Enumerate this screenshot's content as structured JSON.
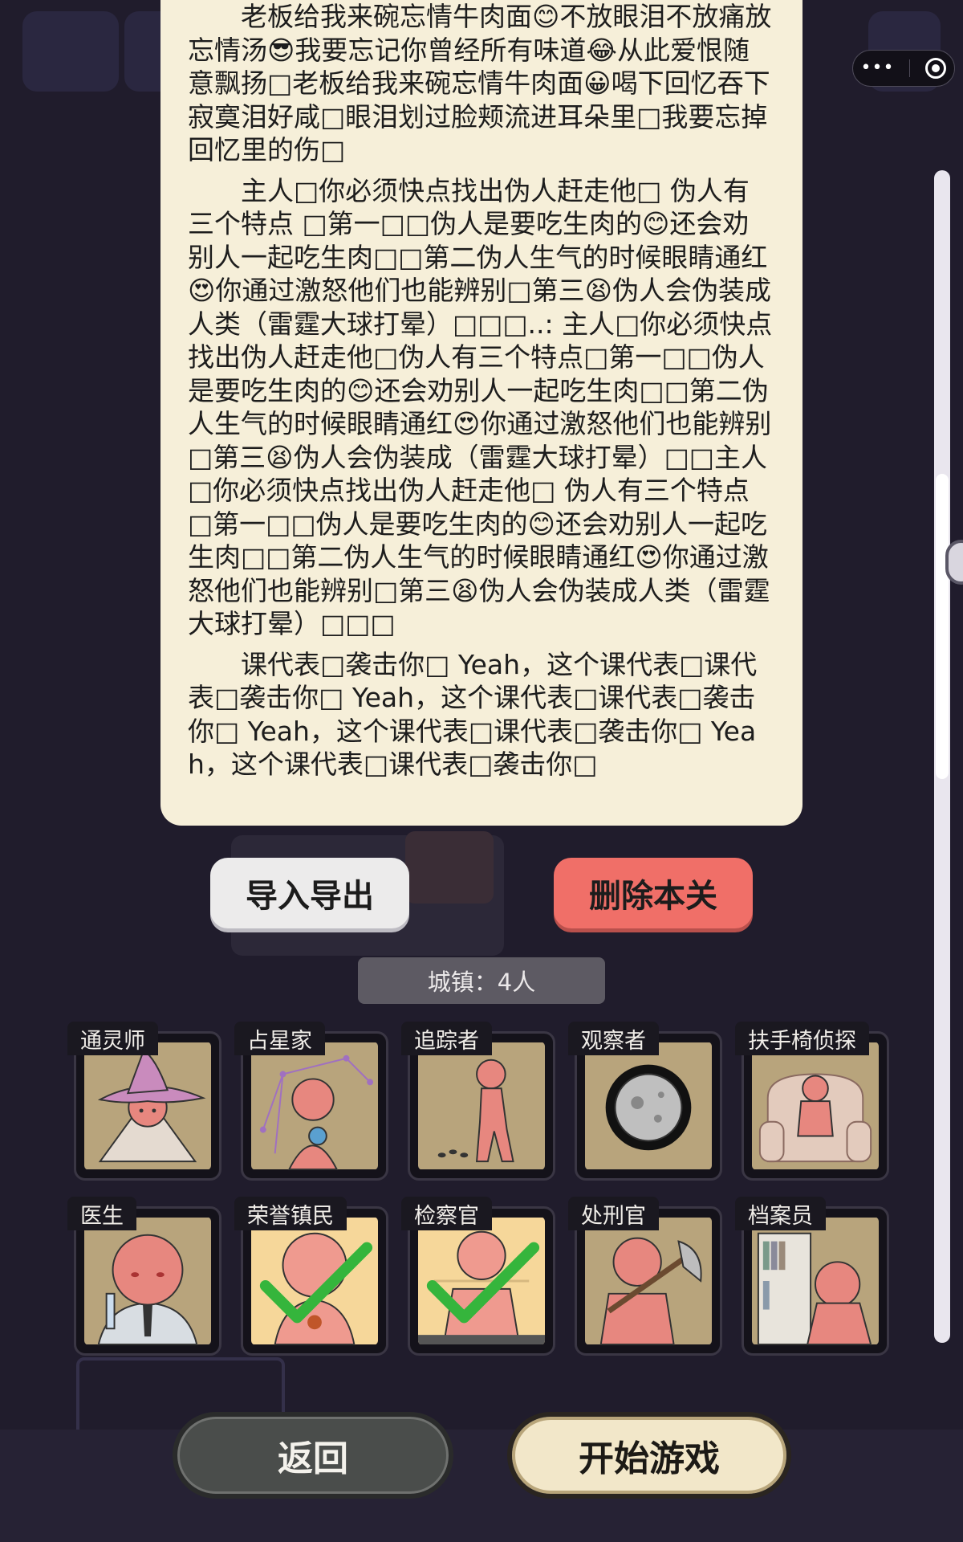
{
  "text_panel": {
    "paragraphs": [
      "老板给我来碗忘情牛肉面😊不放眼泪不放痛放忘情汤😎我要忘记你曾经所有味道😂从此爱恨随意飘扬□老板给我来碗忘情牛肉面😀喝下回忆吞下寂寞泪好咸□眼泪划过脸颊流进耳朵里□我要忘掉回忆里的伤□",
      "主人□你必须快点找出伪人赶走他□ 伪人有三个特点 □第一□□伪人是要吃生肉的😊还会劝别人一起吃生肉□□第二伪人生气的时候眼睛通红😍你通过激怒他们也能辨别□第三😫伪人会伪装成人类（雷霆大球打晕）□□□..: 主人□你必须快点找出伪人赶走他□伪人有三个特点□第一□□伪人是要吃生肉的😊还会劝别人一起吃生肉□□第二伪人生气的时候眼睛通红😍你通过激怒他们也能辨别□第三😫伪人会伪装成（雷霆大球打晕）□□主人□你必须快点找出伪人赶走他□ 伪人有三个特点 □第一□□伪人是要吃生肉的😊还会劝别人一起吃生肉□□第二伪人生气的时候眼睛通红😍你通过激怒他们也能辨别□第三😫伪人会伪装成人类（雷霆大球打晕）□□□",
      "课代表□袭击你□ Yeah，这个课代表□课代表□袭击你□ Yeah，这个课代表□课代表□袭击你□ Yeah，这个课代表□课代表□袭击你□ Yeah，这个课代表□课代表□袭击你□"
    ]
  },
  "buttons": {
    "import_export": "导入导出",
    "delete_level": "删除本关",
    "back": "返回",
    "start_game": "开始游戏"
  },
  "town_label": "城镇：4人",
  "roles": [
    {
      "name": "通灵师",
      "icon": "medium-witch-icon",
      "checked": false
    },
    {
      "name": "占星家",
      "icon": "astrologer-icon",
      "checked": false
    },
    {
      "name": "追踪者",
      "icon": "tracker-icon",
      "checked": false
    },
    {
      "name": "观察者",
      "icon": "observer-eye-icon",
      "checked": false
    },
    {
      "name": "扶手椅侦探",
      "icon": "armchair-detective-icon",
      "checked": false
    },
    {
      "name": "医生",
      "icon": "doctor-icon",
      "checked": false
    },
    {
      "name": "荣誉镇民",
      "icon": "honorary-townsfolk-icon",
      "checked": true
    },
    {
      "name": "检察官",
      "icon": "prosecutor-icon",
      "checked": true
    },
    {
      "name": "处刑官",
      "icon": "executioner-icon",
      "checked": false
    },
    {
      "name": "档案员",
      "icon": "archivist-icon",
      "checked": false
    }
  ],
  "colors": {
    "background": "#201c2c",
    "panel": "#f6efd9",
    "delete_button": "#f06f68",
    "card_art": "#b8a47c",
    "card_art_active": "#f6d79a",
    "check": "#35b53c",
    "figure": "#e7877f"
  },
  "capsule": {
    "more_icon": "more-dots-icon",
    "close_icon": "target-icon"
  }
}
